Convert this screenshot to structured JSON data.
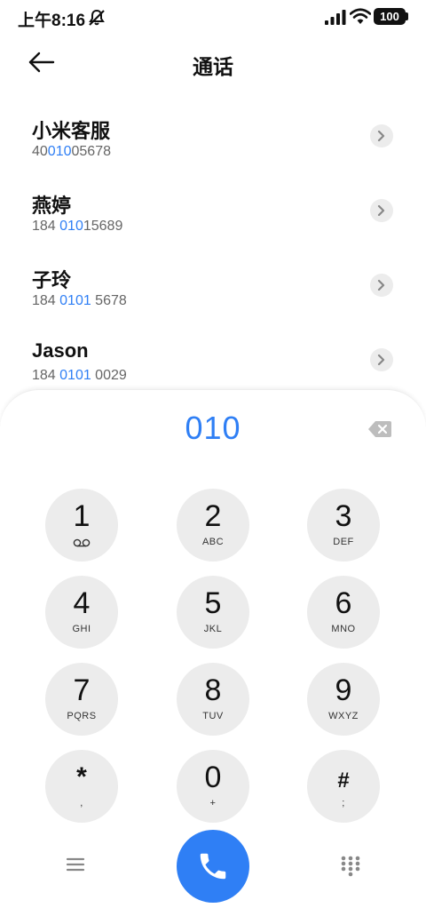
{
  "status_bar": {
    "time": "上午8:16",
    "battery": "100"
  },
  "header": {
    "title": "通话"
  },
  "contacts": [
    {
      "name": "小米客服",
      "number_pre": "40",
      "number_match": "010",
      "number_post": "05678"
    },
    {
      "name": "燕婷",
      "number_pre": "184 ",
      "number_match": "010",
      "number_post": "15689"
    },
    {
      "name": "子玲",
      "number_pre": "184 ",
      "number_match": "0101",
      "number_post": " 5678"
    },
    {
      "name": "Jason",
      "number_pre": "184 ",
      "number_match": "0101",
      "number_post": " 0029"
    }
  ],
  "dialer": {
    "input": "010",
    "keys": [
      {
        "digit": "1",
        "letters": ""
      },
      {
        "digit": "2",
        "letters": "ABC"
      },
      {
        "digit": "3",
        "letters": "DEF"
      },
      {
        "digit": "4",
        "letters": "GHI"
      },
      {
        "digit": "5",
        "letters": "JKL"
      },
      {
        "digit": "6",
        "letters": "MNO"
      },
      {
        "digit": "7",
        "letters": "PQRS"
      },
      {
        "digit": "8",
        "letters": "TUV"
      },
      {
        "digit": "9",
        "letters": "WXYZ"
      },
      {
        "digit": "*",
        "letters": ","
      },
      {
        "digit": "0",
        "letters": "+"
      },
      {
        "digit": "#",
        "letters": ";"
      }
    ]
  },
  "icons": {
    "mute": "bell-off-icon",
    "signal": "signal-icon",
    "wifi": "wifi-icon",
    "back": "arrow-left-icon",
    "detail": "chevron-right-icon",
    "backspace": "backspace-icon",
    "voicemail": "voicemail-icon",
    "menu": "menu-icon",
    "call": "phone-icon",
    "keypad": "keypad-icon"
  },
  "colors": {
    "accent": "#2f7ff5",
    "key_bg": "#ececec",
    "text": "#111111",
    "secondary": "#666666"
  }
}
